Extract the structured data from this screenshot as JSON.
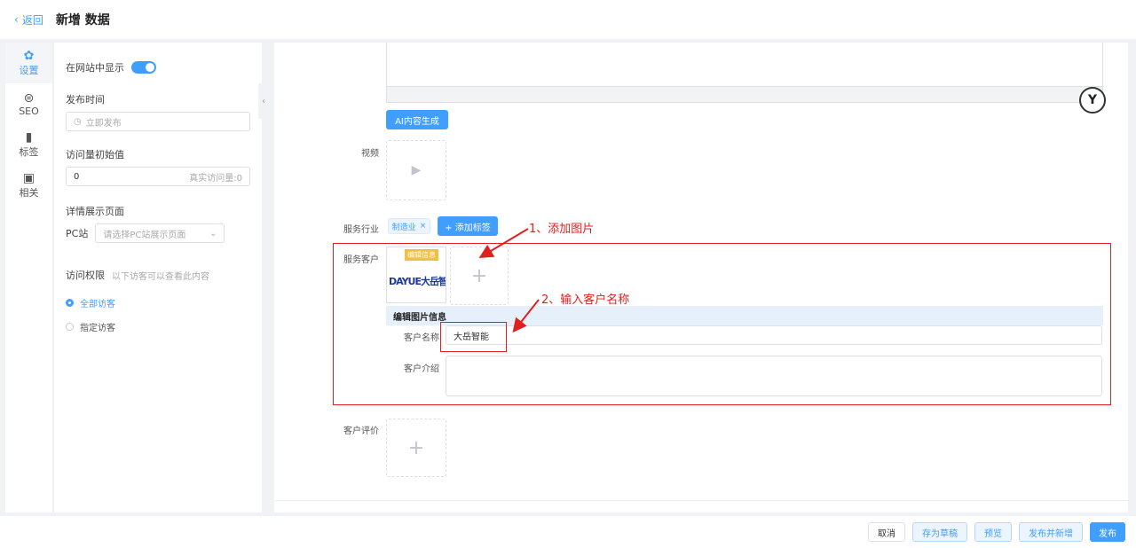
{
  "header": {
    "back_label": "返回",
    "title": "新增 数据"
  },
  "iconbar": [
    {
      "label": "设置",
      "icon": "gear-icon"
    },
    {
      "label": "SEO",
      "icon": "seo-icon"
    },
    {
      "label": "标签",
      "icon": "bookmark-icon"
    },
    {
      "label": "相关",
      "icon": "plus-doc-icon"
    }
  ],
  "settings": {
    "show_on_site": "在网站中显示",
    "publish_time_label": "发布时间",
    "publish_time_placeholder": "立即发布",
    "views_label": "访问量初始值",
    "views_value": "0",
    "views_suffix": "真实访问量:0",
    "detail_page_label": "详情展示页面",
    "pc_label": "PC站",
    "pc_placeholder": "请选择PC站展示页面",
    "access_label": "访问权限",
    "access_hint": "以下访客可以查看此内容",
    "access_all": "全部访客",
    "access_specified": "指定访客"
  },
  "main": {
    "ai_button": "AI内容生成",
    "video_label": "视频",
    "industry_label": "服务行业",
    "industry_tag": "制造业",
    "add_tag_button": "+ 添加标签",
    "customer_label": "服务客户",
    "logo_badge": "编辑信息",
    "logo_text": "DAYUE大岳智能",
    "edit_info_title": "编辑图片信息",
    "customer_name_label": "客户名称",
    "customer_name_value": "大岳智能",
    "customer_intro_label": "客户介绍",
    "review_label": "客户评价"
  },
  "annotations": {
    "step1": "1、添加图片",
    "step2": "2、输入客户名称"
  },
  "footer": {
    "cancel": "取消",
    "save_draft": "存为草稿",
    "preview": "预览",
    "publish_new": "发布并新增",
    "publish": "发布"
  },
  "colors": {
    "accent": "#409eff",
    "annotation": "#e02020"
  }
}
